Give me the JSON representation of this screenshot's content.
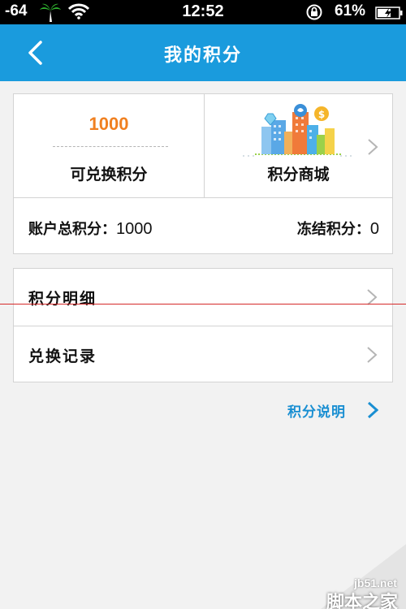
{
  "status_bar": {
    "signal": "-64",
    "time": "12:52",
    "battery_percent": "61%",
    "icons": [
      "palm-tree-icon",
      "wifi-icon",
      "rotation-lock-icon",
      "battery-icon"
    ]
  },
  "nav": {
    "title": "我的积分",
    "back_icon": "chevron-left-icon"
  },
  "points": {
    "redeemable_value": "1000",
    "redeemable_label": "可兑换积分",
    "mall_label": "积分商城",
    "total_label": "账户总积分：",
    "total_value": "1000",
    "frozen_label": "冻结积分：",
    "frozen_value": "0"
  },
  "list": {
    "items": [
      {
        "label": "积分明细"
      },
      {
        "label": "兑换记录"
      }
    ]
  },
  "explain_link": "积分说明",
  "watermark": {
    "domain": "jb51.net",
    "site": "脚本之家"
  },
  "colors": {
    "nav": "#1a9bdd",
    "accent_orange": "#f08020",
    "link_blue": "#1a8fd2",
    "background": "#f2f2f2"
  }
}
